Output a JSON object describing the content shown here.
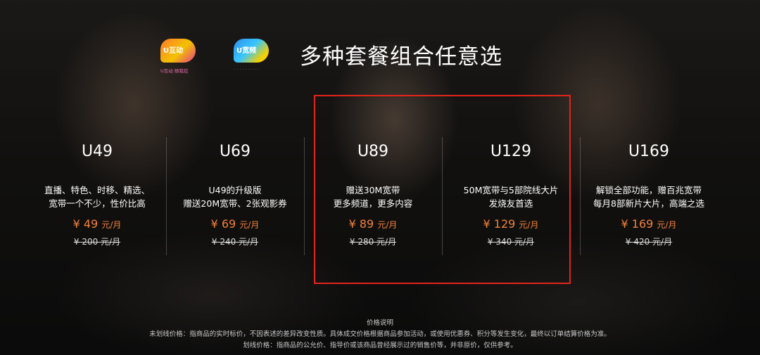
{
  "header": {
    "logos": [
      {
        "name": "u-interact",
        "tag": "U互动",
        "sub": "U互动 随我控",
        "color": "#f2a51b"
      },
      {
        "name": "u-broadband",
        "tag": "U宽频",
        "sub": "· · · · · · · · ·",
        "color": "#2d8ee8"
      }
    ],
    "title": "多种套餐组合任意选"
  },
  "plans": [
    {
      "name": "U49",
      "desc1": "直播、特色、时移、精选、",
      "desc2": "宽带一个不少，性价比高",
      "price": "¥ 49",
      "unit": "元/月",
      "original": "¥ 200 元/月"
    },
    {
      "name": "U69",
      "desc1": "U49的升级版",
      "desc2": "赠送20M宽带、2张观影券",
      "price": "¥ 69",
      "unit": "元/月",
      "original": "¥ 240 元/月"
    },
    {
      "name": "U89",
      "desc1": "赠送30M宽带",
      "desc2": "更多频道，更多内容",
      "price": "¥ 89",
      "unit": "元/月",
      "original": "¥ 280 元/月"
    },
    {
      "name": "U129",
      "desc1": "50M宽带与5部院线大片",
      "desc2": "发烧友首选",
      "price": "¥ 129",
      "unit": "元/月",
      "original": "¥ 340 元/月"
    },
    {
      "name": "U169",
      "desc1": "解锁全部功能，赠百兆宽带",
      "desc2": "每月8部新片大片，高端之选",
      "price": "¥ 169",
      "unit": "元/月",
      "original": "¥ 420 元/月"
    }
  ],
  "highlight_color": "#e1251b",
  "price_color": "#f2813a",
  "notes": {
    "title": "价格说明",
    "line1": "未划线价格：指商品的实时标价，不因表述的差异改变性质。具体成交价格根据商品参加活动，或使用优惠券、积分等发生变化，最终以订单结算价格为准。",
    "line2": "划线价格：指商品的公允价、指导价或该商品曾经展示过的销售价等，并非原价，仅供参考。"
  }
}
